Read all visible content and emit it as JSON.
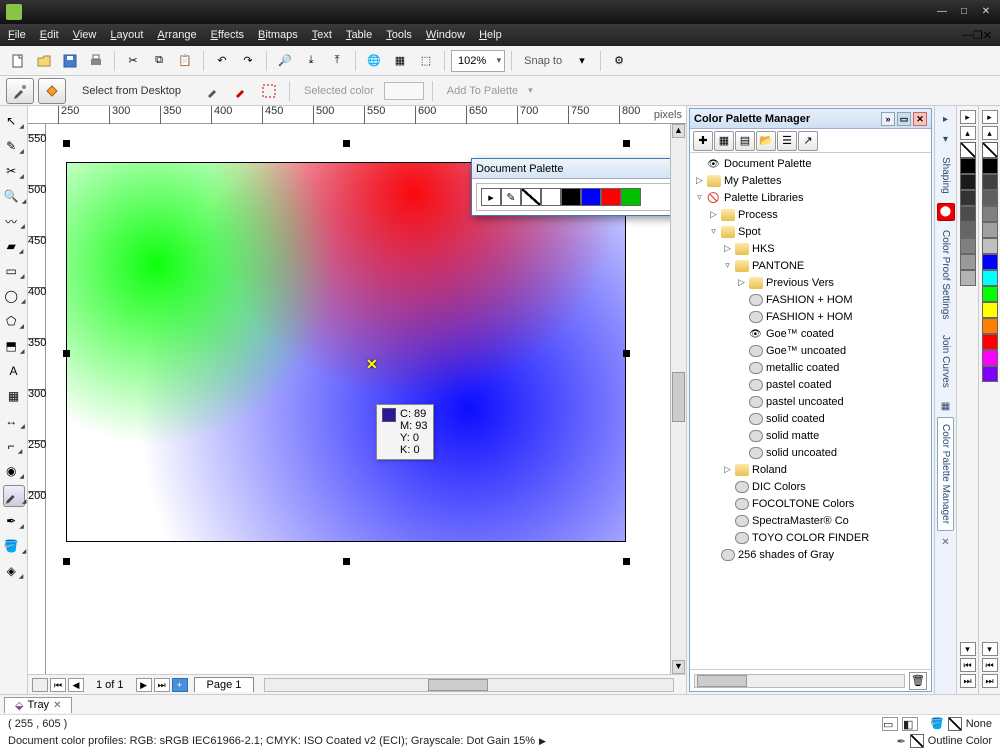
{
  "menus": [
    "File",
    "Edit",
    "View",
    "Layout",
    "Arrange",
    "Effects",
    "Bitmaps",
    "Text",
    "Table",
    "Tools",
    "Window",
    "Help"
  ],
  "toolbar": {
    "zoom": "102%",
    "snap_label": "Snap to"
  },
  "propbar": {
    "select_desktop": "Select from Desktop",
    "selected_color_label": "Selected color",
    "add_to_palette": "Add To Palette"
  },
  "ruler": {
    "h": [
      "250",
      "300",
      "350",
      "400",
      "450",
      "500",
      "550",
      "600",
      "650",
      "700",
      "750",
      "800"
    ],
    "v": [
      "550",
      "500",
      "450",
      "400",
      "350",
      "300",
      "250",
      "200"
    ],
    "units": "pixels"
  },
  "color_tip": {
    "swatch": "#2a1a9a",
    "c": "C: 89",
    "m": "M: 93",
    "y": "Y: 0",
    "k": "K: 0"
  },
  "doc_palette": {
    "title": "Document Palette",
    "swatches": [
      "#ffffff",
      "#000000",
      "#0000ff",
      "#ff0000",
      "#00c000"
    ]
  },
  "navbar": {
    "page_count": "1 of 1",
    "page_tab": "Page 1"
  },
  "docker": {
    "title": "Color Palette Manager",
    "tree": [
      {
        "depth": 0,
        "exp": "",
        "icon": "eye",
        "label": "Document Palette"
      },
      {
        "depth": 0,
        "exp": "▷",
        "icon": "folder",
        "label": "My Palettes"
      },
      {
        "depth": 0,
        "exp": "▿",
        "icon": "lib",
        "label": "Palette Libraries"
      },
      {
        "depth": 1,
        "exp": "▷",
        "icon": "folder",
        "label": "Process"
      },
      {
        "depth": 1,
        "exp": "▿",
        "icon": "folder",
        "label": "Spot"
      },
      {
        "depth": 2,
        "exp": "▷",
        "icon": "folder",
        "label": "HKS"
      },
      {
        "depth": 2,
        "exp": "▿",
        "icon": "folder",
        "label": "PANTONE"
      },
      {
        "depth": 3,
        "exp": "▷",
        "icon": "folder",
        "label": "Previous Vers"
      },
      {
        "depth": 3,
        "exp": "",
        "icon": "pal",
        "label": "FASHION + HOM"
      },
      {
        "depth": 3,
        "exp": "",
        "icon": "pal",
        "label": "FASHION + HOM"
      },
      {
        "depth": 3,
        "exp": "",
        "icon": "eye",
        "label": "Goe™ coated"
      },
      {
        "depth": 3,
        "exp": "",
        "icon": "pal",
        "label": "Goe™ uncoated"
      },
      {
        "depth": 3,
        "exp": "",
        "icon": "pal",
        "label": "metallic coated"
      },
      {
        "depth": 3,
        "exp": "",
        "icon": "pal",
        "label": "pastel coated"
      },
      {
        "depth": 3,
        "exp": "",
        "icon": "pal",
        "label": "pastel uncoated"
      },
      {
        "depth": 3,
        "exp": "",
        "icon": "pal",
        "label": "solid coated"
      },
      {
        "depth": 3,
        "exp": "",
        "icon": "pal",
        "label": "solid matte"
      },
      {
        "depth": 3,
        "exp": "",
        "icon": "pal",
        "label": "solid uncoated"
      },
      {
        "depth": 2,
        "exp": "▷",
        "icon": "folder",
        "label": "Roland"
      },
      {
        "depth": 2,
        "exp": "",
        "icon": "pal",
        "label": "DIC Colors"
      },
      {
        "depth": 2,
        "exp": "",
        "icon": "pal",
        "label": "FOCOLTONE Colors"
      },
      {
        "depth": 2,
        "exp": "",
        "icon": "pal",
        "label": "SpectraMaster® Co"
      },
      {
        "depth": 2,
        "exp": "",
        "icon": "pal",
        "label": "TOYO COLOR FINDER"
      },
      {
        "depth": 1,
        "exp": "",
        "icon": "pal",
        "label": "256 shades of Gray"
      }
    ]
  },
  "dock_tabs": [
    "Shaping",
    "Color Proof Settings",
    "Join Curves",
    "Color Palette Manager"
  ],
  "palette_default": [
    "#000000",
    "#404040",
    "#606060",
    "#808080",
    "#a0a0a0",
    "#c0c0c0",
    "#0000ff",
    "#00ffff",
    "#00ff00",
    "#ffff00",
    "#ff8000",
    "#ff0000",
    "#ff00ff",
    "#8000ff"
  ],
  "palette_gray": [
    "#000000",
    "#1a1a1a",
    "#333333",
    "#4d4d4d",
    "#666666",
    "#808080",
    "#999999",
    "#b3b3b3"
  ],
  "tray": {
    "label": "Tray"
  },
  "status": {
    "coords": "( 255  , 605 )",
    "profiles": "Document color profiles: RGB: sRGB IEC61966-2.1; CMYK: ISO Coated v2 (ECI); Grayscale: Dot Gain 15%",
    "fill_none": "None",
    "outline": "Outline Color"
  }
}
